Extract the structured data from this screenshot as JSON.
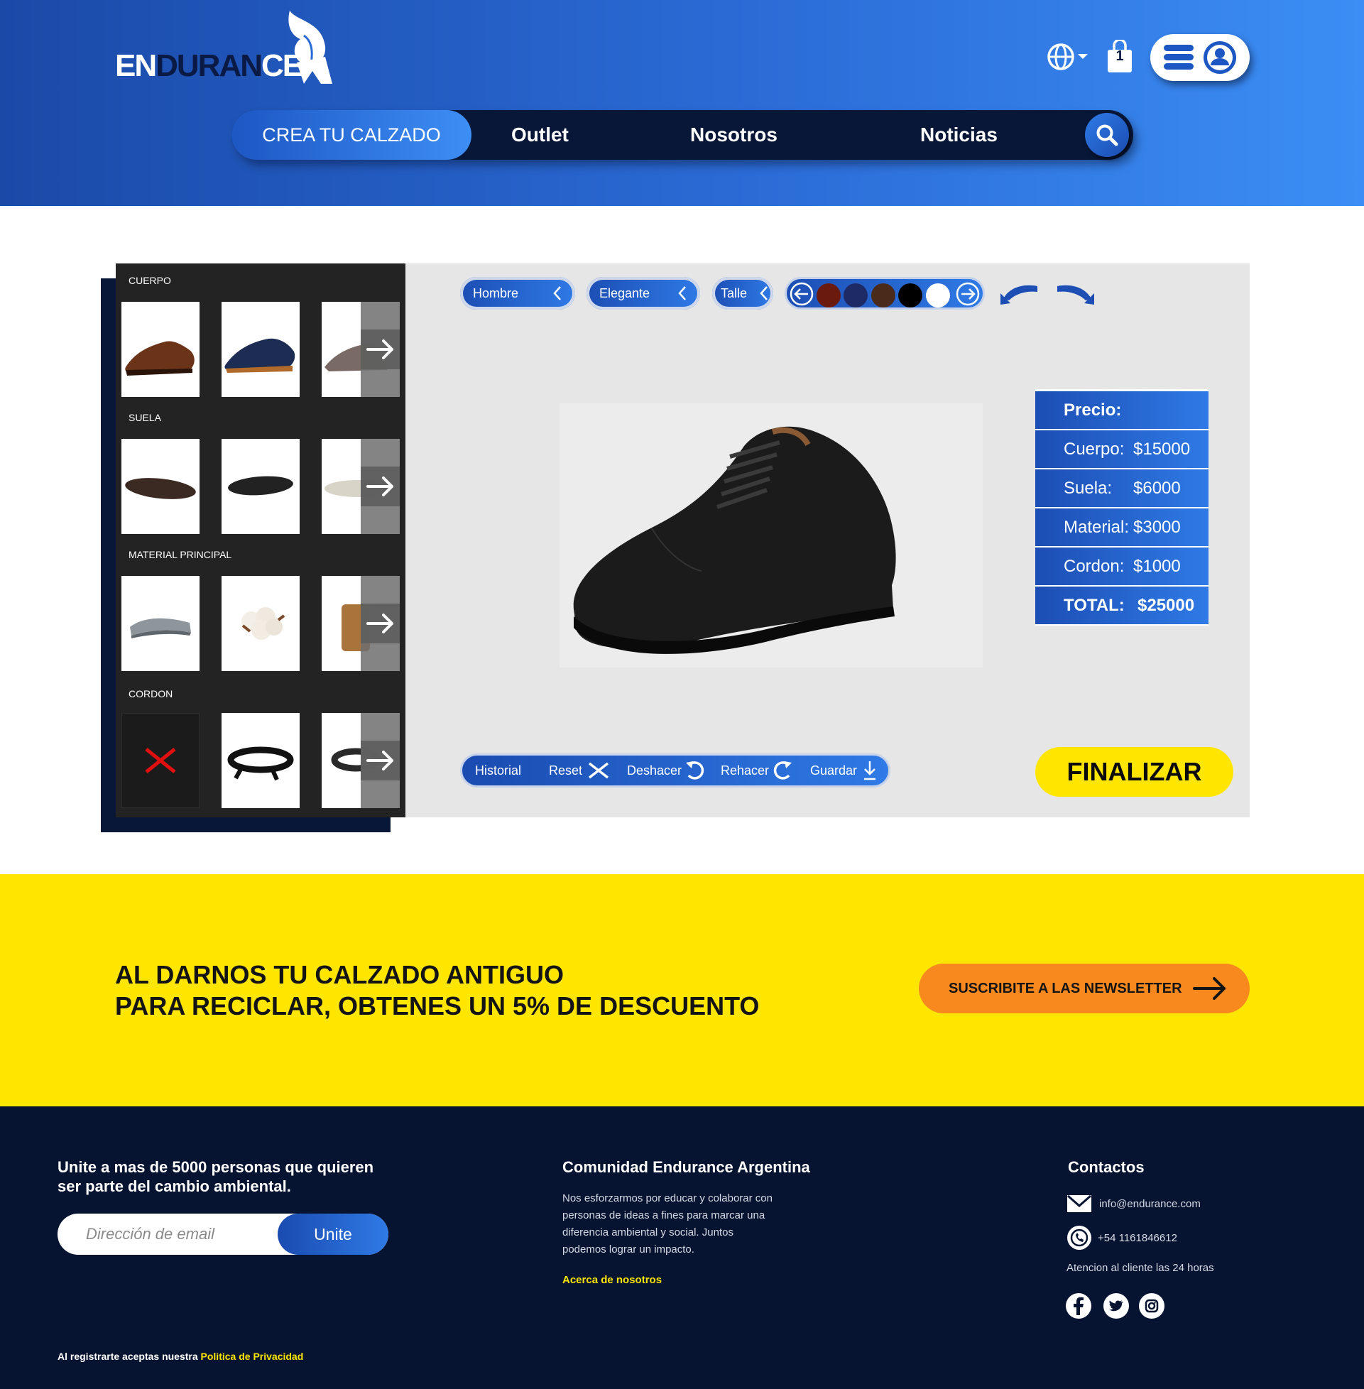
{
  "header": {
    "logo": {
      "text_light_1": "EN",
      "text_dark": "DURAN",
      "text_light_2": "CE"
    },
    "cart_count": "1",
    "nav": {
      "create": "CREA TU CALZADO",
      "outlet": "Outlet",
      "about": "Nosotros",
      "news": "Noticias"
    }
  },
  "customizer": {
    "categories": [
      {
        "label": "CUERPO"
      },
      {
        "label": "SUELA"
      },
      {
        "label": "MATERIAL PRINCIPAL"
      },
      {
        "label": "CORDON"
      }
    ],
    "filters": {
      "gender": "Hombre",
      "style": "Elegante",
      "size": "Talle"
    },
    "colors": [
      "#6b1a10",
      "#1e2a66",
      "#4a2a1a",
      "#000000",
      "#ffffff"
    ],
    "price": {
      "title": "Precio:",
      "rows": [
        {
          "label": "Cuerpo:",
          "value": "$15000"
        },
        {
          "label": "Suela:",
          "value": "$6000"
        },
        {
          "label": "Material:",
          "value": "$3000"
        },
        {
          "label": "Cordon:",
          "value": "$1000"
        }
      ],
      "total_label": "TOTAL:",
      "total_value": "$25000"
    },
    "toolbar": {
      "history": "Historial",
      "reset": "Reset",
      "undo": "Deshacer",
      "redo": "Rehacer",
      "save": "Guardar"
    },
    "finish": "FINALIZAR"
  },
  "banner": {
    "line1": "AL DARNOS TU CALZADO ANTIGUO",
    "line2": "PARA RECICLAR, OBTENES UN 5% DE DESCUENTO",
    "cta": "SUSCRIBITE A LAS NEWSLETTER"
  },
  "footer": {
    "join_title_1": "Unite a mas de 5000 personas que quieren",
    "join_title_2": "ser parte del cambio ambiental.",
    "email_placeholder": "Dirección de email",
    "join_button": "Unite",
    "community_title": "Comunidad Endurance Argentina",
    "community_text": [
      "Nos esforzarmos por educar y colaborar con",
      "personas de ideas a fines para marcar una",
      "diferencia ambiental y social. Juntos",
      "podemos lograr un impacto."
    ],
    "about_link": "Acerca de nosotros",
    "contacts_title": "Contactos",
    "email": "info@endurance.com",
    "phone": "+54 1161846612",
    "support": "Atencion al cliente las 24 horas",
    "legal_text": "Al registrarte aceptas nuestra ",
    "legal_link": "Politica de Privacidad"
  }
}
